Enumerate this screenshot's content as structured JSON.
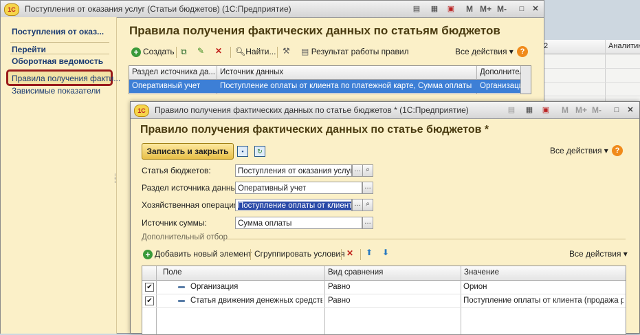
{
  "bg_table": {
    "col1": "2",
    "col2": "Аналитик"
  },
  "window1": {
    "title": "Поступления от оказания услуг (Статьи бюджетов) (1С:Предприятие)",
    "logo": "1С",
    "title_buttons": [
      "M",
      "M+",
      "M-"
    ],
    "sidebar": {
      "header": "Поступления от оказ...",
      "section": "Перейти",
      "bold_item": "Оборотная ведомость",
      "items": [
        "Правила получения факти...",
        "Зависимые показатели"
      ]
    },
    "heading": "Правила получения фактических данных по статьям бюджетов",
    "toolbar": {
      "create": "Создать",
      "find": "Найти...",
      "result": "Результат работы правил",
      "all_actions": "Все действия ▾",
      "help": "?"
    },
    "table": {
      "columns": [
        "Раздел источника да...",
        "Источник данных",
        "Дополнител"
      ],
      "rows": [
        [
          "Оперативный учет",
          "Поступление оплаты от клиента по платежной карте, Сумма оплаты",
          "Организаци"
        ]
      ]
    }
  },
  "window2": {
    "title": "Правило получения фактических данных по статье бюджетов * (1С:Предприятие)",
    "logo": "1С",
    "title_buttons": [
      "M",
      "M+",
      "M-"
    ],
    "heading": "Правило получения фактических данных по статье бюджетов *",
    "save_close": "Записать и закрыть",
    "all_actions": "Все действия ▾",
    "help": "?",
    "fields": [
      {
        "label": "Статья бюджетов:",
        "value": "Поступления от оказания услуг"
      },
      {
        "label": "Раздел источника данных:",
        "value": "Оперативный учет"
      },
      {
        "label": "Хозяйственная операция:",
        "value": "Поступление оплаты от клиента"
      },
      {
        "label": "Источник суммы:",
        "value": "Сумма оплаты"
      }
    ],
    "group": "Дополнительный отбор",
    "filter_toolbar": {
      "add": "Добавить новый элемент",
      "group": "Сгруппировать условия",
      "all_actions": "Все действия ▾"
    },
    "filter_table": {
      "columns": [
        "Поле",
        "Вид сравнения",
        "Значение"
      ],
      "rows": [
        {
          "checked": "✔",
          "field": "Организация",
          "compare": "Равно",
          "value": "Орион"
        },
        {
          "checked": "✔",
          "field": "Статья движения денежных средств",
          "compare": "Равно",
          "value": "Поступление оплаты от клиента (продажа р..."
        }
      ]
    }
  },
  "colors": {
    "accent": "#fbf0c8",
    "selection": "#3d7fd6",
    "highlight": "#9a1a1a"
  }
}
